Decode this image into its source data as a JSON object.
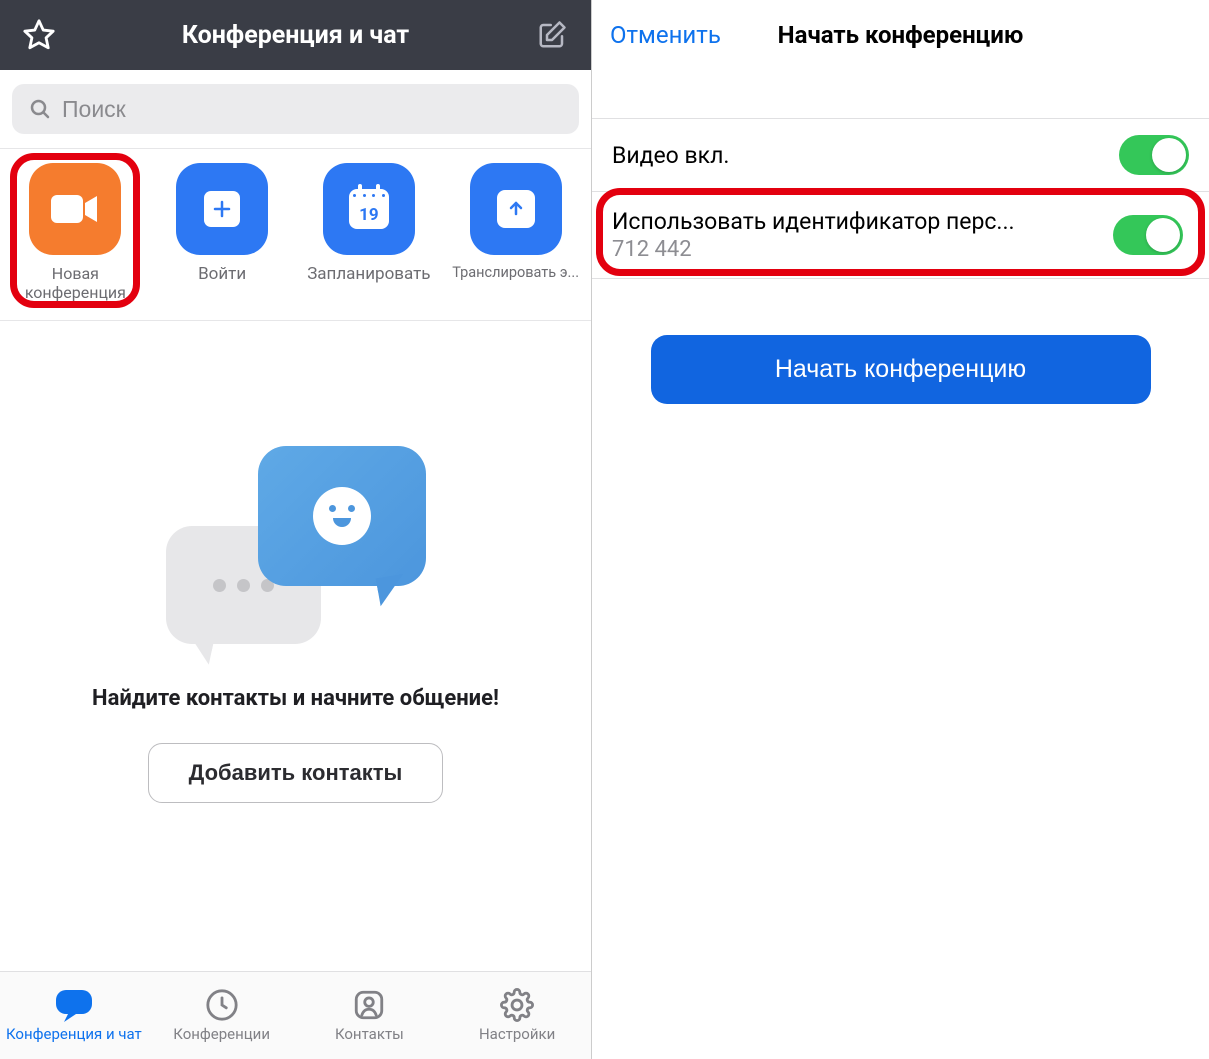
{
  "left": {
    "header": {
      "title": "Конференция и чат"
    },
    "search": {
      "placeholder": "Поиск"
    },
    "actions": {
      "new_meeting": "Новая конференция",
      "join": "Войти",
      "schedule": "Запланировать",
      "schedule_day": "19",
      "share": "Транслировать э..."
    },
    "empty": {
      "title": "Найдите контакты и начните общение!",
      "add_contacts": "Добавить контакты"
    },
    "tabs": {
      "chat": "Конференция и чат",
      "meetings": "Конференции",
      "contacts": "Контакты",
      "settings": "Настройки"
    }
  },
  "right": {
    "cancel": "Отменить",
    "title": "Начать конференцию",
    "video_on": "Видео вкл.",
    "use_pmi_label": "Использовать идентификатор перс...",
    "pmi_value": "712 442",
    "start_button": "Начать конференцию"
  },
  "colors": {
    "orange": "#f57c2e",
    "blue": "#2d78f3",
    "primary": "#0e72ed",
    "green": "#34c759",
    "highlight": "#e3000f"
  }
}
